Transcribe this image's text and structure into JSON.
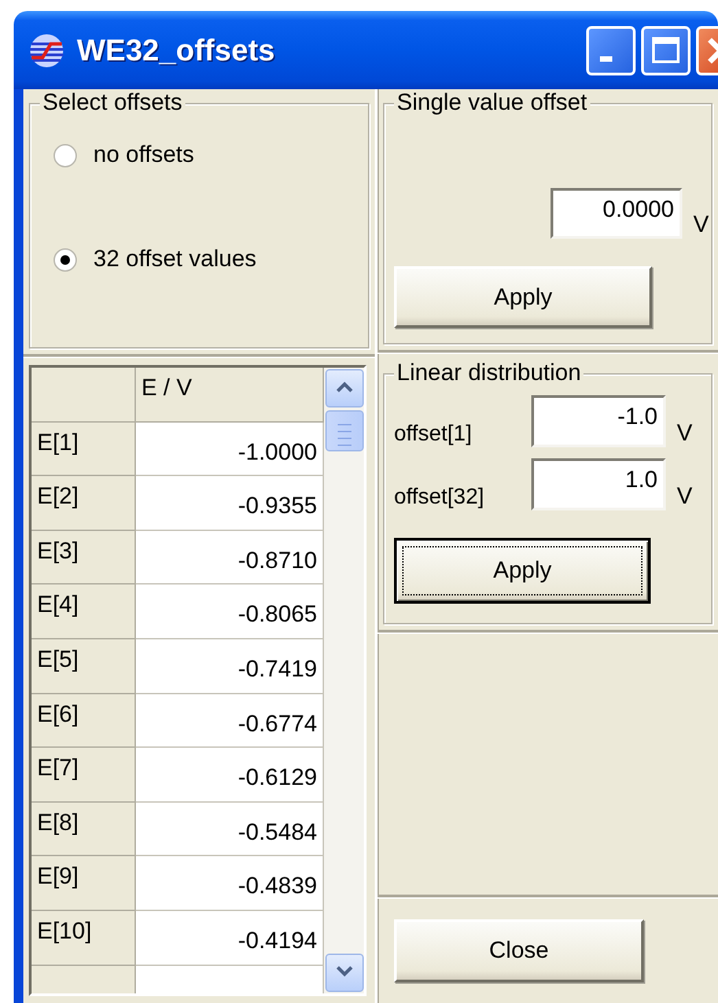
{
  "window": {
    "title": "WE32_offsets"
  },
  "select_offsets": {
    "title": "Select offsets",
    "options": [
      {
        "label": "no offsets",
        "selected": false
      },
      {
        "label": "32 offset values",
        "selected": true
      }
    ]
  },
  "offsets_table": {
    "columns": [
      "E / V"
    ],
    "rows": [
      {
        "label": "E[1]",
        "value": "-1.0000"
      },
      {
        "label": "E[2]",
        "value": "-0.9355"
      },
      {
        "label": "E[3]",
        "value": "-0.8710"
      },
      {
        "label": "E[4]",
        "value": "-0.8065"
      },
      {
        "label": "E[5]",
        "value": "-0.7419"
      },
      {
        "label": "E[6]",
        "value": "-0.6774"
      },
      {
        "label": "E[7]",
        "value": "-0.6129"
      },
      {
        "label": "E[8]",
        "value": "-0.5484"
      },
      {
        "label": "E[9]",
        "value": "-0.4839"
      },
      {
        "label": "E[10]",
        "value": "-0.4194"
      }
    ]
  },
  "single_value_offset": {
    "title": "Single value offset",
    "value": "0.0000",
    "unit": "V",
    "button": {
      "label": "Apply",
      "focused": false
    }
  },
  "linear_distribution": {
    "title": "Linear distribution",
    "fields": [
      {
        "label": "offset[1]",
        "value": "-1.0",
        "unit": "V"
      },
      {
        "label": "offset[32]",
        "value": "1.0",
        "unit": "V"
      }
    ],
    "button": {
      "label": "Apply",
      "focused": true
    }
  },
  "close_button": {
    "label": "Close",
    "focused": false
  }
}
